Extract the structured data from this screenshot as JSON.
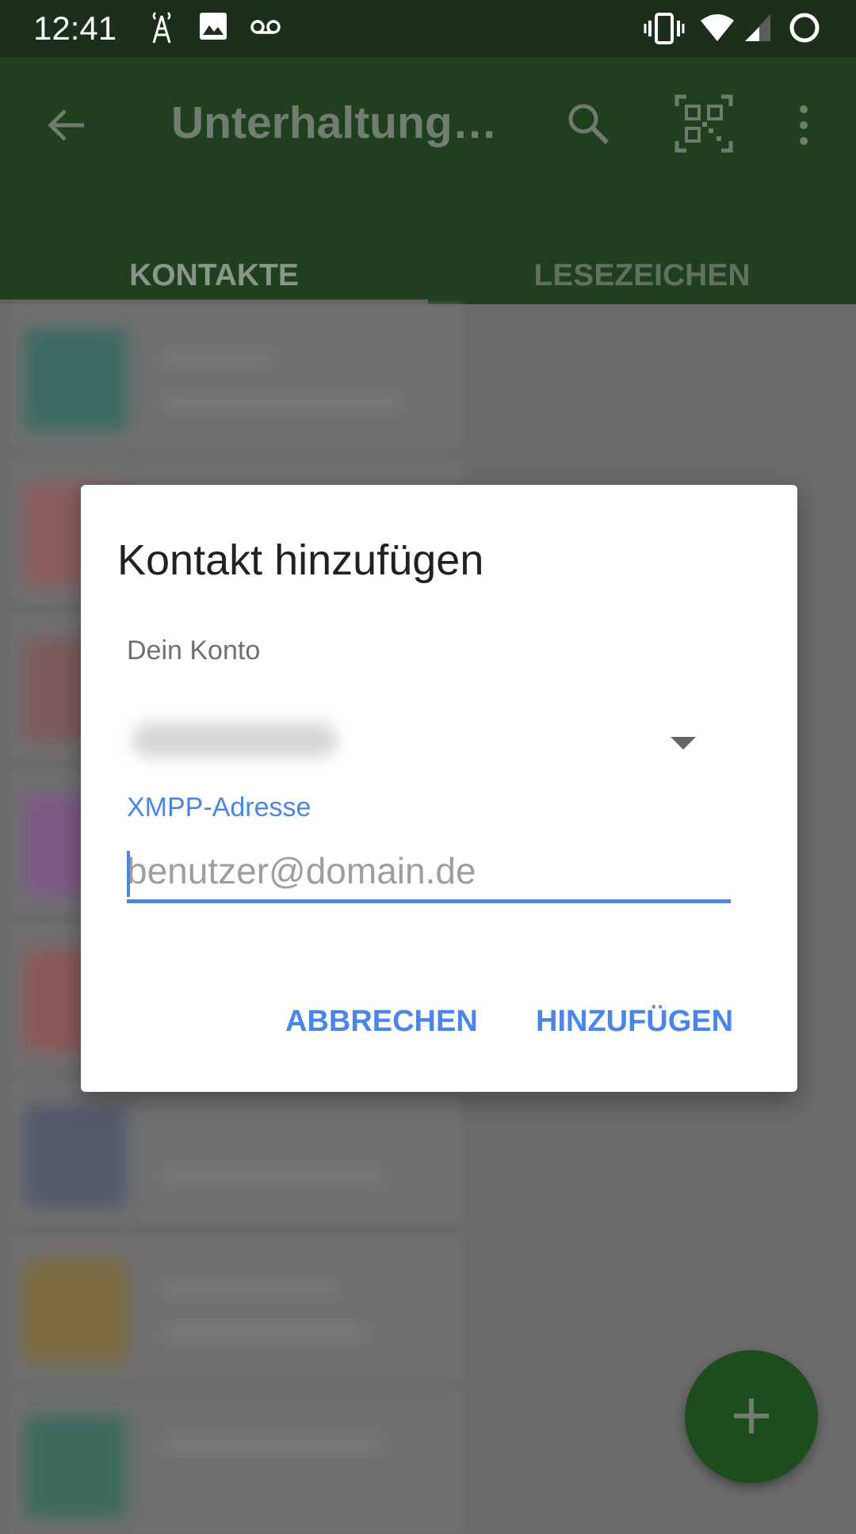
{
  "status_bar": {
    "time": "12:41",
    "left_icons": [
      "antenna-icon",
      "image-icon",
      "voicemail-icon"
    ],
    "right_icons": [
      "vibrate-icon",
      "wifi-icon",
      "signal-icon",
      "battery-saver-icon"
    ]
  },
  "app_bar": {
    "title": "Unterhaltung…",
    "icons": [
      "back-arrow-icon",
      "search-icon",
      "qr-code-icon",
      "overflow-menu-icon"
    ],
    "tabs": [
      {
        "label": "KONTAKTE",
        "active": true
      },
      {
        "label": "LESEZEICHEN",
        "active": false
      }
    ]
  },
  "dialog": {
    "title": "Kontakt hinzufügen",
    "account_label": "Dein Konto",
    "address_label": "XMPP-Adresse",
    "address_placeholder": "benutzer@domain.de",
    "address_value": "",
    "cancel_label": "ABBRECHEN",
    "add_label": "HINZUFÜGEN"
  },
  "fab": {
    "icon": "plus-icon"
  },
  "colors": {
    "primary_dimmed": "#1f3f1f",
    "accent": "#4a86e8",
    "scrim": "#6b6b6b"
  }
}
